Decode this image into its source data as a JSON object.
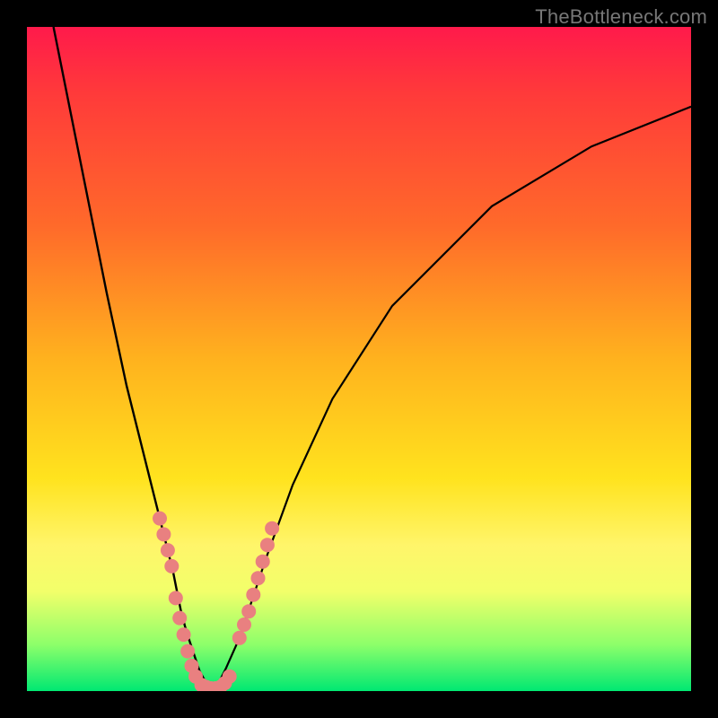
{
  "watermark": "TheBottleneck.com",
  "chart_data": {
    "type": "line",
    "title": "",
    "xlabel": "",
    "ylabel": "",
    "xlim": [
      0,
      100
    ],
    "ylim": [
      0,
      100
    ],
    "grid": false,
    "annotations": [
      "TheBottleneck.com"
    ],
    "colors": {
      "gradient_top": "#ff1a4b",
      "gradient_bottom": "#00e872",
      "curve": "#000000",
      "dots": "#e98080",
      "frame": "#000000"
    },
    "curve_left": {
      "name": "left-branch",
      "x": [
        4,
        8,
        12,
        15,
        18,
        20,
        22,
        22.6,
        23.2,
        24,
        25,
        26,
        27,
        28
      ],
      "y": [
        100,
        80,
        60,
        46,
        34,
        26,
        18,
        15,
        12,
        9,
        6,
        3,
        1.2,
        0.4
      ]
    },
    "curve_right": {
      "name": "right-branch",
      "x": [
        28,
        29,
        30,
        32,
        33,
        34,
        36,
        40,
        46,
        55,
        70,
        85,
        100
      ],
      "y": [
        0.4,
        1.5,
        3.5,
        8,
        11,
        14,
        20,
        31,
        44,
        58,
        73,
        82,
        88
      ]
    },
    "dots_left": {
      "x": [
        20.0,
        20.6,
        21.2,
        21.8,
        22.4,
        23.0,
        23.6,
        24.2,
        24.8,
        25.4
      ],
      "y": [
        26.0,
        23.6,
        21.2,
        18.8,
        14.0,
        11.0,
        8.5,
        6.0,
        3.8,
        2.2
      ]
    },
    "dots_right": {
      "x": [
        32.0,
        32.7,
        33.4,
        34.1,
        34.8,
        35.5,
        36.2,
        36.9
      ],
      "y": [
        8.0,
        10.0,
        12.0,
        14.5,
        17.0,
        19.5,
        22.0,
        24.5
      ]
    },
    "dots_bottom": {
      "x": [
        26.3,
        27.0,
        27.7,
        28.4,
        29.1,
        29.8,
        30.5
      ],
      "y": [
        0.9,
        0.6,
        0.4,
        0.4,
        0.6,
        1.2,
        2.2
      ]
    }
  }
}
